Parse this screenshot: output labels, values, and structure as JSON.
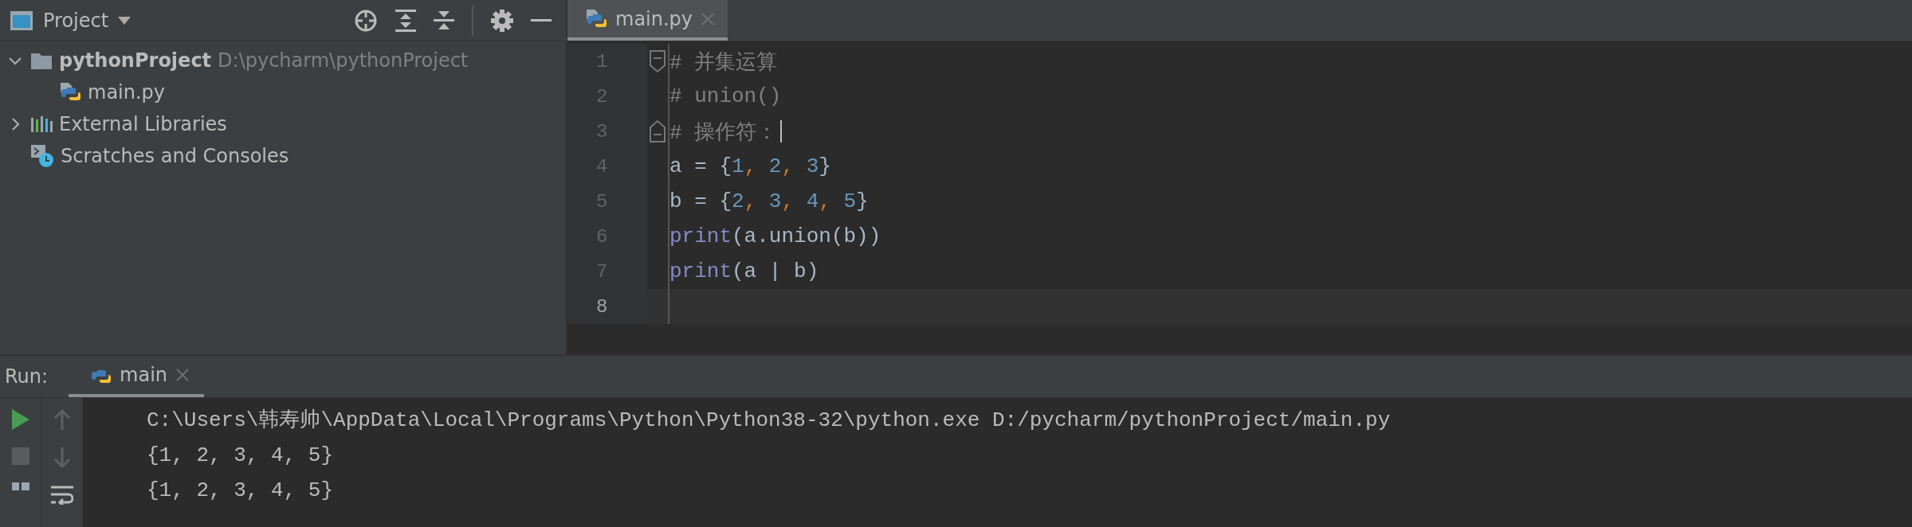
{
  "project_panel": {
    "title": "Project",
    "tree": [
      {
        "kind": "project",
        "label": "pythonProject",
        "hint": "D:\\pycharm\\pythonProject",
        "expanded": true,
        "children": [
          {
            "kind": "file",
            "label": "main.py"
          }
        ]
      },
      {
        "kind": "libraries",
        "label": "External Libraries",
        "expanded": false
      },
      {
        "kind": "scratches",
        "label": "Scratches and Consoles"
      }
    ]
  },
  "editor": {
    "tabs": [
      {
        "label": "main.py",
        "selected": true
      }
    ],
    "lines": [
      {
        "number": "1",
        "kind": "foldstart",
        "tokens": [
          {
            "kind": "comment",
            "text": "# 并集运算"
          }
        ]
      },
      {
        "number": "2",
        "kind": "plain",
        "tokens": [
          {
            "kind": "comment",
            "text": "# union()"
          }
        ]
      },
      {
        "number": "3",
        "kind": "foldend",
        "caret": true,
        "tokens": [
          {
            "kind": "comment",
            "text": "# 操作符："
          }
        ]
      },
      {
        "number": "4",
        "kind": "plain",
        "tokens": [
          {
            "kind": "plain",
            "text": "a = {"
          },
          {
            "kind": "number",
            "text": "1"
          },
          {
            "kind": "comma",
            "text": ", "
          },
          {
            "kind": "number",
            "text": "2"
          },
          {
            "kind": "comma",
            "text": ", "
          },
          {
            "kind": "number",
            "text": "3"
          },
          {
            "kind": "plain",
            "text": "}"
          }
        ]
      },
      {
        "number": "5",
        "kind": "plain",
        "tokens": [
          {
            "kind": "plain",
            "text": "b = {"
          },
          {
            "kind": "number",
            "text": "2"
          },
          {
            "kind": "comma",
            "text": ", "
          },
          {
            "kind": "number",
            "text": "3"
          },
          {
            "kind": "comma",
            "text": ", "
          },
          {
            "kind": "number",
            "text": "4"
          },
          {
            "kind": "comma",
            "text": ", "
          },
          {
            "kind": "number",
            "text": "5"
          },
          {
            "kind": "plain",
            "text": "}"
          }
        ]
      },
      {
        "number": "6",
        "kind": "plain",
        "tokens": [
          {
            "kind": "builtin",
            "text": "print"
          },
          {
            "kind": "plain",
            "text": "(a.union(b))"
          }
        ]
      },
      {
        "number": "7",
        "kind": "plain",
        "tokens": [
          {
            "kind": "builtin",
            "text": "print"
          },
          {
            "kind": "plain",
            "text": "(a | b)"
          }
        ]
      },
      {
        "number": "8",
        "kind": "plain",
        "current": true
      }
    ]
  },
  "run_panel": {
    "label": "Run:",
    "tabs": [
      {
        "label": "main",
        "selected": true
      }
    ],
    "output": [
      "C:\\Users\\韩寿帅\\AppData\\Local\\Programs\\Python\\Python38-32\\python.exe D:/pycharm/pythonProject/main.py",
      "{1, 2, 3, 4, 5}",
      "{1, 2, 3, 4, 5}"
    ]
  }
}
